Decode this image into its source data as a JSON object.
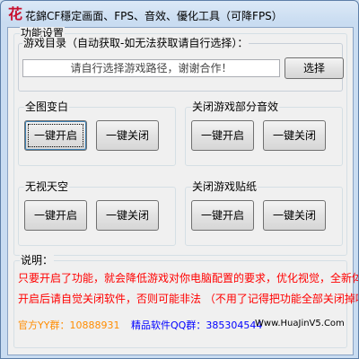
{
  "window": {
    "icon_char": "花",
    "title": "花錦CF穩定画面、FPS、音效、優化工具（可降FPS）"
  },
  "settings": {
    "legend": "功能设置",
    "game_dir": {
      "legend": "游戏目录（自动获取-如无法获取请自行选择）：",
      "path_value": "请自行选择游戏路径，谢谢合作！",
      "browse_label": "选择"
    },
    "groups": [
      {
        "legend": "全图变白",
        "on_label": "一键开启",
        "off_label": "一键关闭"
      },
      {
        "legend": "关闭游戏部分音效",
        "on_label": "一键开启",
        "off_label": "一键关闭"
      },
      {
        "legend": "无视天空",
        "on_label": "一键开启",
        "off_label": "一键关闭"
      },
      {
        "legend": "关闭游戏贴纸",
        "on_label": "一键开启",
        "off_label": "一键关闭"
      }
    ]
  },
  "notes": {
    "legend": "说明：",
    "line1": "只要开启了功能，就会降低游戏对你电脑配置的要求，优化视觉，全新体验！",
    "line2": "开启后请自觉关闭软件，否则可能非法 （不用了记得把功能全部关闭掉哦）",
    "yy_label": "官方YY群：",
    "yy_value": "10888931",
    "qq_label": "精品软件QQ群：",
    "qq_value": "385304544",
    "website": "Www.HuaJinV5.Com"
  },
  "colors": {
    "warning": "#ff0000",
    "yy": "#ff8c00",
    "qq": "#0000ff",
    "title_icon": "#c8102e"
  }
}
